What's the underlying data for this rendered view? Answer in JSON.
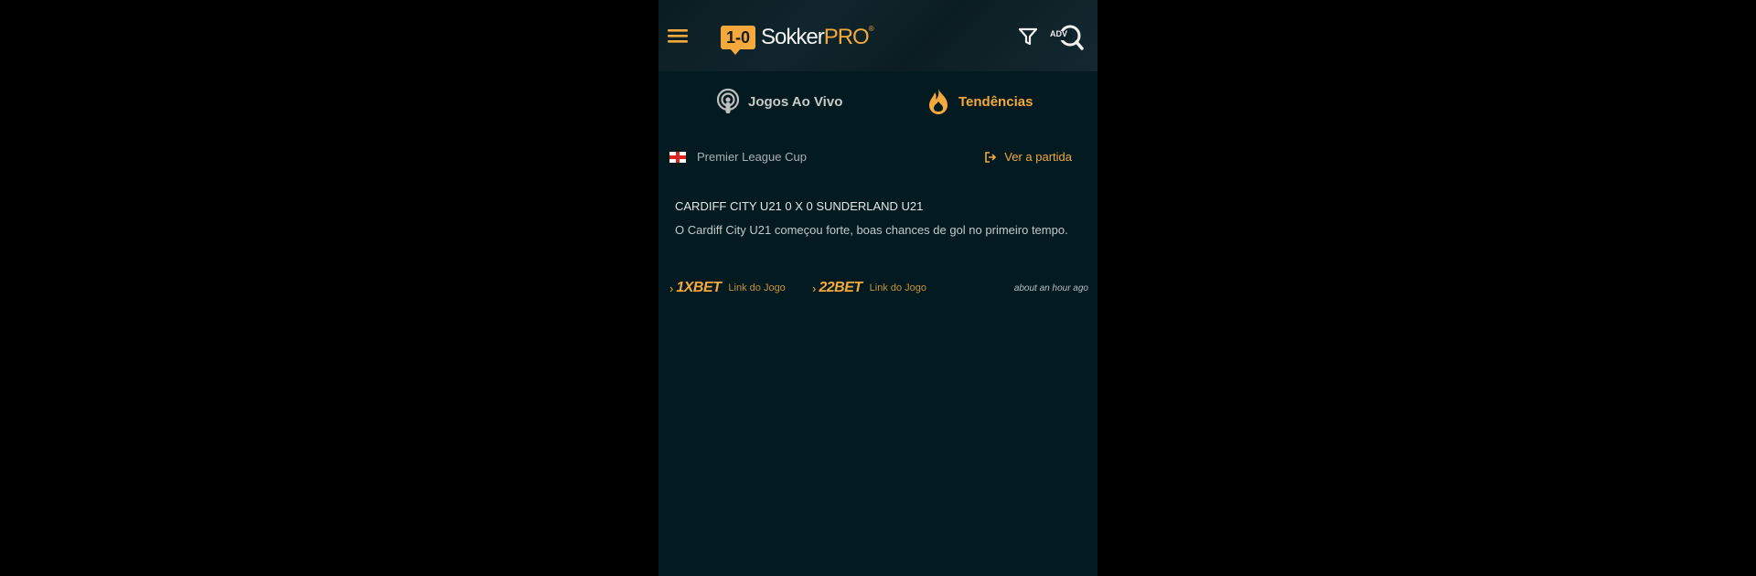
{
  "app": {
    "logo_score": "1-0",
    "logo_name": "Sokker",
    "logo_suffix": "PRO",
    "logo_reg": "®",
    "adv_label": "ADV"
  },
  "tabs": [
    {
      "label": "Jogos Ao Vivo",
      "icon": "podcast-icon",
      "active": false
    },
    {
      "label": "Tendências",
      "icon": "flame-icon",
      "active": true
    }
  ],
  "match": {
    "league": "Premier League Cup",
    "country_flag": "england-flag-icon",
    "see_match_label": "Ver a partida",
    "title": "CARDIFF CITY U21 0 X 0 SUNDERLAND U21",
    "description": "O Cardiff City U21 começou forte, boas chances de gol no primeiro tempo.",
    "bets": [
      {
        "brand": "1XBET",
        "link_label": "Link do Jogo"
      },
      {
        "brand": "22BET",
        "link_label": "Link do Jogo"
      }
    ],
    "time_ago": "about an hour ago"
  },
  "colors": {
    "accent": "#f3a93b",
    "background": "#031a21",
    "header": "#0d2127"
  }
}
